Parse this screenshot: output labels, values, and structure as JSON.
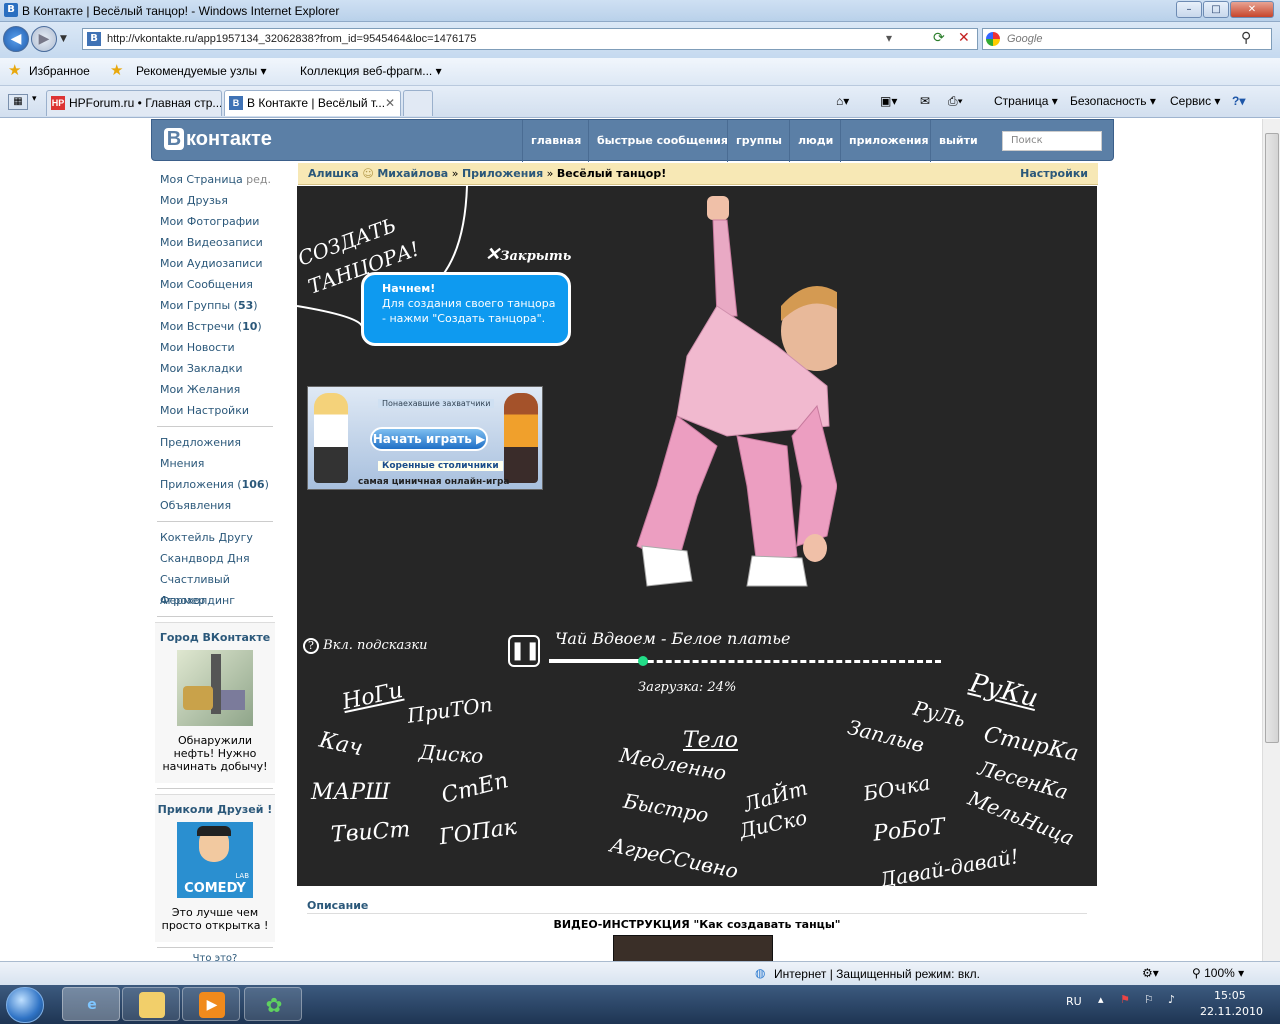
{
  "window": {
    "title": "В Контакте | Весёлый танцор! - Windows Internet Explorer",
    "min": "–",
    "max": "□",
    "close": "✕"
  },
  "address": {
    "url": "http://vkontakte.ru/app1957134_32062838?from_id=9545464&loc=1476175",
    "search_placeholder": "Google"
  },
  "favorites": {
    "label": "Избранное",
    "items": [
      "Рекомендуемые узлы ▾",
      "Коллекция веб-фрагм... ▾"
    ]
  },
  "tabs": [
    {
      "label": "HPForum.ru • Главная стр...",
      "icon": "HP"
    },
    {
      "label": "В Контакте | Весёлый т...",
      "icon": "B"
    }
  ],
  "commands": [
    "Страница ▾",
    "Безопасность ▾",
    "Сервис ▾"
  ],
  "vk": {
    "logo": "контакте",
    "logo_letter": "B",
    "nav": [
      "главная",
      "быстрые сообщения",
      "группы",
      "люди",
      "приложения",
      "выйти"
    ],
    "search_placeholder": "Поиск"
  },
  "sidebar": {
    "edit": "ред.",
    "group1": [
      {
        "label": "Моя Страница",
        "count": ""
      },
      {
        "label": "Мои Друзья",
        "count": ""
      },
      {
        "label": "Мои Фотографии",
        "count": ""
      },
      {
        "label": "Мои Видеозаписи",
        "count": ""
      },
      {
        "label": "Мои Аудиозаписи",
        "count": ""
      },
      {
        "label": "Мои Сообщения",
        "count": ""
      },
      {
        "label": "Мои Группы",
        "count": "53"
      },
      {
        "label": "Мои Встречи",
        "count": "10"
      },
      {
        "label": "Мои Новости",
        "count": ""
      },
      {
        "label": "Мои Закладки",
        "count": ""
      },
      {
        "label": "Мои Желания",
        "count": ""
      },
      {
        "label": "Мои Настройки",
        "count": ""
      }
    ],
    "group2": [
      {
        "label": "Предложения",
        "count": ""
      },
      {
        "label": "Мнения",
        "count": ""
      },
      {
        "label": "Приложения",
        "count": "106"
      },
      {
        "label": "Объявления",
        "count": ""
      }
    ],
    "group3": [
      "Коктейль Другу",
      "Скандворд Дня",
      "Счастливый Фермер",
      "Агрохолдинг"
    ],
    "promo1": {
      "title": "Город ВКонтакте",
      "desc": "Обнаружили нефть! Нужно начинать добычу!"
    },
    "promo2": {
      "title": "Приколи Друзей !",
      "desc": "Это лучше чем просто открытка !",
      "badge": "COMEDY",
      "lab": "LAB"
    },
    "whatis": "Что это?"
  },
  "breadcrumb": {
    "user": "Алишка",
    "user2": "Михайлова",
    "apps": "Приложения",
    "current": "Весёлый танцор!",
    "sep": "»",
    "settings": "Настройки"
  },
  "game": {
    "create": "СОЗДАТЬ ТАНЦОРА!",
    "close": "Закрыть",
    "bubble_title": "Начнем!",
    "bubble_text": "Для создания своего танцора - нажми \"Создать танцора\".",
    "ad_play": "Начать играть",
    "ad_tag": "самая циничная онлайн-игра",
    "ad_top": "Понаехавшие захватчики",
    "ad_bottom": "Коренные столичники",
    "hints": "Вкл. подсказки",
    "track": "Чай Вдвоем - Белое платье",
    "loading": "Загрузка: 24%",
    "progress": 0.24,
    "legs_title": "НоГи",
    "legs": [
      "ПриТОп",
      "Кач",
      "Диско",
      "МАРШ",
      "СтЕп",
      "ТвиСт",
      "ГОПак"
    ],
    "body_title": "Тело",
    "body": [
      "Медленно",
      "Быстро",
      "ЛаЙт",
      "ДиСко",
      "АгреССивно"
    ],
    "arms_title": "РуКи",
    "arms": [
      "Заплыв",
      "РуЛь",
      "СтирКа",
      "ЛесенКа",
      "БОчка",
      "МельНица",
      "РоБоТ",
      "Давай-давай!"
    ]
  },
  "footer": {
    "desc_title": "Описание",
    "video_title": "ВИДЕО-ИНСТРУКЦИЯ \"Как создавать танцы\""
  },
  "status": {
    "zone": "Интернет | Защищенный режим: вкл.",
    "zoom": "100%"
  },
  "taskbar": {
    "lang": "RU",
    "time": "15:05",
    "date": "22.11.2010"
  }
}
